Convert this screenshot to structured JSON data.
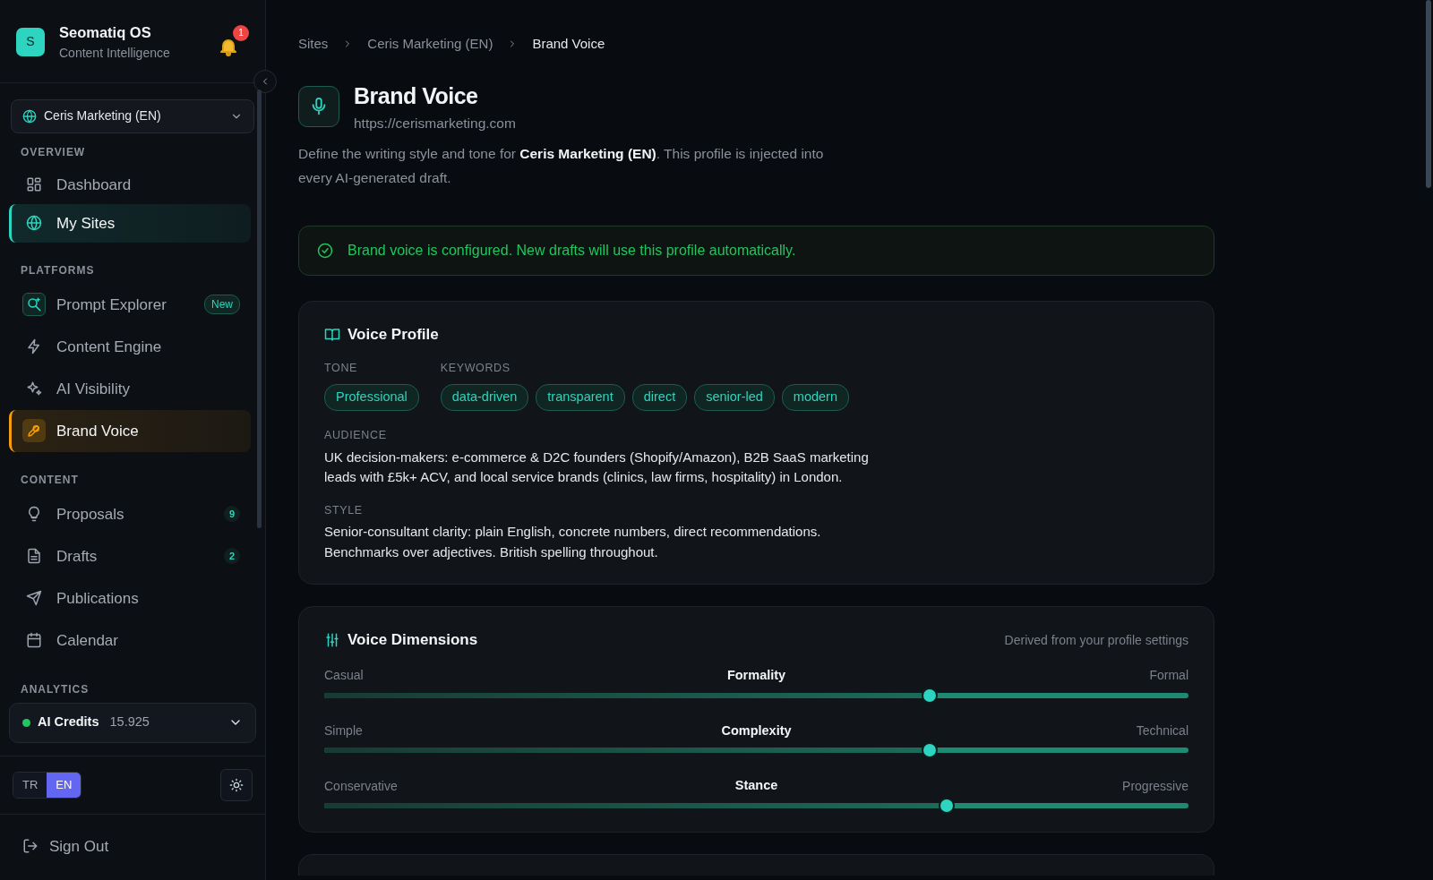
{
  "app": {
    "logo_letter": "S",
    "name": "Seomatiq OS",
    "subtitle": "Content Intelligence",
    "notifications": "1"
  },
  "site_selector": {
    "value": "Ceris Marketing (EN)"
  },
  "nav_sections": [
    {
      "title": "OVERVIEW",
      "items": [
        {
          "label": "Dashboard",
          "selected": false
        },
        {
          "label": "My Sites",
          "selected": true,
          "color": "#2dd4bf"
        }
      ]
    },
    {
      "title": "PLATFORMS",
      "items": [
        {
          "label": "Prompt Explorer",
          "selected": false,
          "badge": "New"
        },
        {
          "label": "Content Engine",
          "selected": false
        },
        {
          "label": "AI Visibility",
          "selected": false
        },
        {
          "label": "Brand Voice",
          "selected": true,
          "color": "#f59e0b"
        }
      ]
    },
    {
      "title": "CONTENT",
      "items": [
        {
          "label": "Proposals",
          "selected": false,
          "count": "9"
        },
        {
          "label": "Drafts",
          "selected": false,
          "count": "2"
        },
        {
          "label": "Publications",
          "selected": false
        },
        {
          "label": "Calendar",
          "selected": false
        }
      ]
    }
  ],
  "analytics_heading": "ANALYTICS",
  "credits": {
    "label": "AI Credits",
    "value": "15.925"
  },
  "languages": [
    {
      "label": "TR",
      "selected": false
    },
    {
      "label": "EN",
      "selected": true
    }
  ],
  "sign_out": "Sign Out",
  "breadcrumb": [
    "Sites",
    "Ceris Marketing (EN)",
    "Brand Voice"
  ],
  "page": {
    "title": "Brand Voice",
    "url": "https://cerismarketing.com",
    "description": "Define the writing style and tone for **Ceris Marketing (EN)**. This profile is injected into every AI-generated draft."
  },
  "alert": "Brand voice is configured. New drafts will use this profile automatically.",
  "voice_profile": {
    "title": "Voice Profile",
    "tone_label": "TONE",
    "tones": [
      "Professional"
    ],
    "keywords_label": "KEYWORDS",
    "keywords": [
      "data-driven",
      "transparent",
      "direct",
      "senior-led",
      "modern"
    ],
    "audience_label": "AUDIENCE",
    "audience": "UK decision-makers: e-commerce & D2C founders (Shopify/Amazon), B2B SaaS marketing leads with £5k+ ACV, and local service brands (clinics, law firms, hospitality) in London.",
    "style_label": "STYLE",
    "style": "Senior-consultant clarity: plain English, concrete numbers, direct recommendations. Benchmarks over adjectives. British spelling throughout."
  },
  "voice_dimensions": {
    "title": "Voice Dimensions",
    "note": "Derived from your profile settings",
    "sliders": [
      {
        "name": "Formality",
        "left": "Casual",
        "right": "Formal",
        "level": 0.7
      },
      {
        "name": "Complexity",
        "left": "Simple",
        "right": "Technical",
        "level": 0.7
      },
      {
        "name": "Stance",
        "left": "Conservative",
        "right": "Progressive",
        "level": 0.72
      }
    ]
  }
}
